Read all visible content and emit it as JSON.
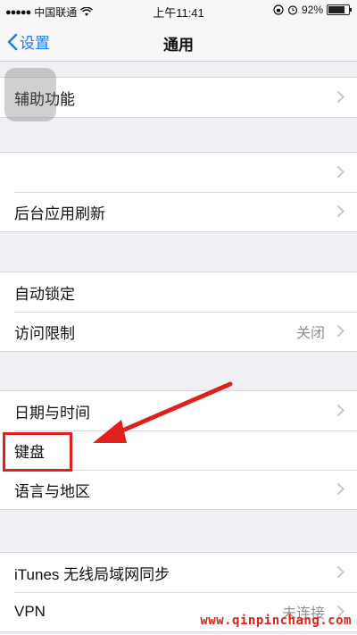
{
  "status_bar": {
    "signal": "●●●●●",
    "carrier": "中国联通",
    "time": "上午11:41",
    "battery": "92%",
    "battery_level": 0.92
  },
  "nav": {
    "back_label": "设置",
    "title": "通用"
  },
  "groups": [
    {
      "cells": [
        {
          "label": "辅助功能"
        }
      ]
    },
    {
      "cells": [
        {
          "label": ""
        },
        {
          "label": "后台应用刷新"
        }
      ]
    },
    {
      "cells": [
        {
          "label": "自动锁定"
        },
        {
          "label": "访问限制",
          "detail": "关闭"
        }
      ]
    },
    {
      "cells": [
        {
          "label": "日期与时间"
        },
        {
          "label": "键盘"
        },
        {
          "label": "语言与地区"
        }
      ]
    },
    {
      "cells": [
        {
          "label": "iTunes 无线局域网同步"
        },
        {
          "label": "VPN",
          "detail": "未连接"
        }
      ]
    }
  ],
  "watermark": "www.qinpinchang.com",
  "colors": {
    "accent": "#1a7bf2",
    "annotation": "#e0201a",
    "background": "#efeff4"
  }
}
